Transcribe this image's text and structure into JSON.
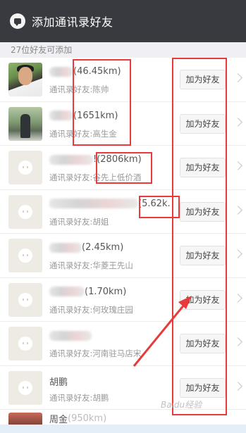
{
  "header": {
    "title": "添加通讯录好友"
  },
  "subheader": "27位好友可添加",
  "add_button_label": "加为好友",
  "contacts": [
    {
      "name_visible": "",
      "distance": "(46.45km)",
      "friend": "通讯录好友:陈帅"
    },
    {
      "name_visible": "",
      "distance": "(1651km)",
      "friend": "通讯录好友:高生金"
    },
    {
      "name_visible": "!",
      "distance": "(2806km)",
      "friend": "通讯录好友:谷先上低价酒"
    },
    {
      "name_visible": "",
      "distance": "(5.62k.",
      "friend": "通讯录好友:胡姐"
    },
    {
      "name_visible": "",
      "distance": "(2.45km)",
      "friend": "通讯录好友:华菱王先山"
    },
    {
      "name_visible": "",
      "distance": "(1.70km)",
      "friend": "通讯录好友:何玫瑰庄园"
    },
    {
      "name_visible": "",
      "distance": "",
      "friend": "通讯录好友:河南驻马店宋"
    },
    {
      "name_visible": "胡鹏",
      "distance": "",
      "friend": "通讯录好友:胡鹏"
    },
    {
      "name_visible": "周金",
      "distance": "(950km)",
      "friend": ""
    }
  ],
  "colors": {
    "topbar": "#393a3f",
    "annotation": "#e83a3a"
  },
  "watermark": "Baidu经验"
}
